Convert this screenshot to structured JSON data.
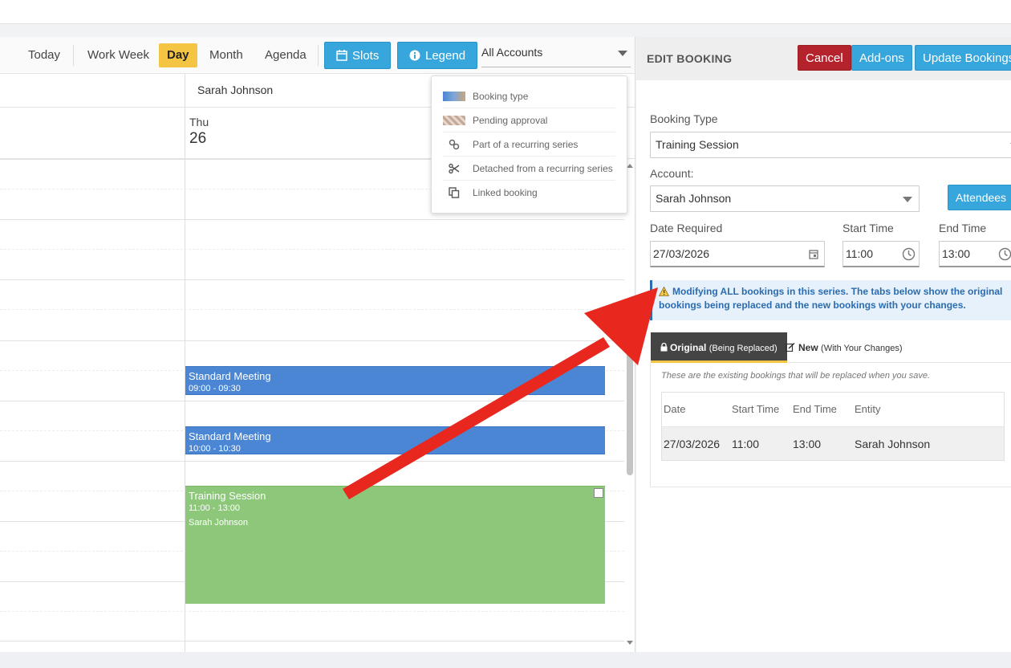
{
  "toolbar": {
    "today": "Today",
    "work_week": "Work Week",
    "day": "Day",
    "month": "Month",
    "agenda": "Agenda",
    "slots": "Slots",
    "legend": "Legend",
    "account_filter": "All Accounts"
  },
  "calendar": {
    "resource": "Sarah Johnson",
    "day_name": "Thu",
    "day_number": "26",
    "events": [
      {
        "title": "Standard Meeting",
        "time": "09:00 - 09:30",
        "who": ""
      },
      {
        "title": "Standard Meeting",
        "time": "10:00 - 10:30",
        "who": ""
      },
      {
        "title": "Training Session",
        "time": "11:00 - 13:00",
        "who": "Sarah Johnson"
      }
    ]
  },
  "legend": {
    "items": [
      {
        "icon": "booking-type-swatch",
        "label": "Booking type"
      },
      {
        "icon": "pending-approval-swatch",
        "label": "Pending approval"
      },
      {
        "icon": "link-icon",
        "label": "Part of a recurring series"
      },
      {
        "icon": "scissors-icon",
        "label": "Detached from a recurring series"
      },
      {
        "icon": "copy-icon",
        "label": "Linked booking"
      }
    ]
  },
  "panel": {
    "title": "EDIT BOOKING",
    "cancel": "Cancel",
    "addons": "Add-ons",
    "update": "Update Bookings",
    "booking_type_label": "Booking Type",
    "booking_type_value": "Training Session",
    "account_label": "Account:",
    "account_value": "Sarah Johnson",
    "attendees": "Attendees",
    "date_label": "Date Required",
    "date_value": "27/03/2026",
    "start_label": "Start Time",
    "start_value": "11:00",
    "end_label": "End Time",
    "end_value": "13:00",
    "notice": "Modifying ALL bookings in this series. The tabs below show the original bookings being replaced and the new bookings with your changes.",
    "tab_original": "Original",
    "tab_original_sub": "(Being Replaced)",
    "tab_new": "New",
    "tab_new_sub": "(With Your Changes)",
    "table_note": "These are the existing bookings that will be replaced when you save.",
    "table": {
      "headers": [
        "Date",
        "Start Time",
        "End Time",
        "Entity"
      ],
      "rows": [
        [
          "27/03/2026",
          "11:00",
          "13:00",
          "Sarah Johnson"
        ]
      ]
    }
  },
  "colors": {
    "accent": "#36a6dd",
    "danger": "#b4232b",
    "active_tab": "#f4c542",
    "event_blue": "#4a86d4",
    "event_green": "#8dc87a",
    "annotation_arrow": "#e8281f"
  }
}
